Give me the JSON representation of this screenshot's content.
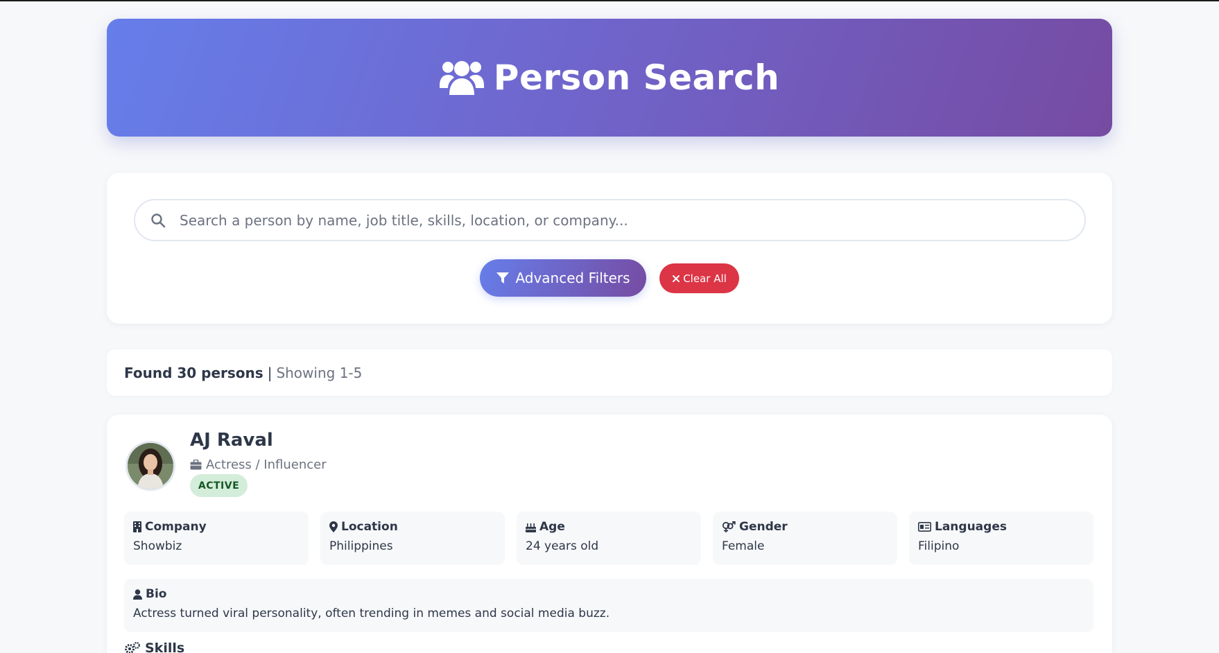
{
  "header": {
    "title": "Person Search",
    "icon": "users-icon"
  },
  "search": {
    "placeholder": "Search a person by name, job title, skills, location, or company...",
    "value": ""
  },
  "buttons": {
    "advanced_filters": "Advanced Filters",
    "clear_all": "Clear All"
  },
  "results": {
    "found": "Found 30 persons",
    "separator": "|",
    "showing": "Showing 1-5"
  },
  "person": {
    "name": "AJ Raval",
    "title": "Actress / Influencer",
    "status": "ACTIVE",
    "info": [
      {
        "label": "Company",
        "value": "Showbiz",
        "icon": "building-icon"
      },
      {
        "label": "Location",
        "value": "Philippines",
        "icon": "map-pin-icon"
      },
      {
        "label": "Age",
        "value": "24 years old",
        "icon": "birthday-cake-icon"
      },
      {
        "label": "Gender",
        "value": "Female",
        "icon": "venus-mars-icon"
      },
      {
        "label": "Languages",
        "value": "Filipino",
        "icon": "id-card-icon"
      }
    ],
    "bio": {
      "label": "Bio",
      "value": "Actress turned viral personality, often trending in memes and social media buzz."
    },
    "skills_label": "Skills"
  },
  "colors": {
    "accent_start": "#667eea",
    "accent_end": "#764ba2",
    "danger": "#dc3545",
    "active_bg": "#d4edda",
    "active_text": "#155724"
  }
}
